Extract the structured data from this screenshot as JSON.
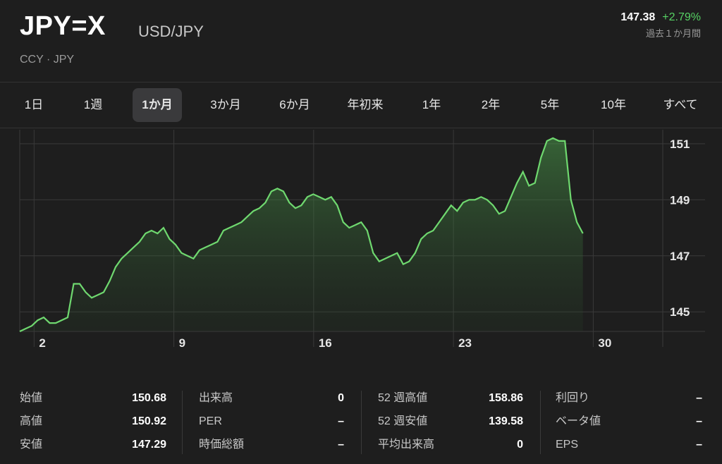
{
  "header": {
    "symbol": "JPY=X",
    "pair": "USD/JPY",
    "meta": "CCY · JPY",
    "price": "147.38",
    "change": "+2.79%",
    "period": "過去１か月間",
    "change_color": "#56d364"
  },
  "tabs": [
    {
      "label": "1日"
    },
    {
      "label": "1週"
    },
    {
      "label": "1か月",
      "active": true
    },
    {
      "label": "3か月"
    },
    {
      "label": "6か月"
    },
    {
      "label": "年初来"
    },
    {
      "label": "1年"
    },
    {
      "label": "2年"
    },
    {
      "label": "5年"
    },
    {
      "label": "10年"
    },
    {
      "label": "すべて"
    }
  ],
  "chart_data": {
    "type": "area",
    "x_ticks": [
      "2",
      "9",
      "16",
      "23",
      "30"
    ],
    "y_ticks": [
      "151",
      "149",
      "147",
      "145"
    ],
    "ylim": [
      144.3,
      151.5
    ],
    "xlim": [
      0,
      32.2
    ],
    "grid": true,
    "line_color": "#6fd86f",
    "x": [
      0,
      0.3,
      0.6,
      0.9,
      1.2,
      1.5,
      1.8,
      2.1,
      2.4,
      2.7,
      3.0,
      3.3,
      3.6,
      3.9,
      4.2,
      4.5,
      4.8,
      5.1,
      5.4,
      5.7,
      6.0,
      6.3,
      6.6,
      6.9,
      7.2,
      7.5,
      7.8,
      8.1,
      8.4,
      8.7,
      9.0,
      9.3,
      9.6,
      9.9,
      10.2,
      10.5,
      10.8,
      11.1,
      11.4,
      11.7,
      12.0,
      12.3,
      12.6,
      12.9,
      13.2,
      13.5,
      13.8,
      14.1,
      14.4,
      14.7,
      15.0,
      15.3,
      15.6,
      15.9,
      16.2,
      16.5,
      16.8,
      17.1,
      17.4,
      17.7,
      18.0,
      18.3,
      18.6,
      18.9,
      19.2,
      19.5,
      19.8,
      20.1,
      20.4,
      20.7,
      21.0,
      21.3,
      21.6,
      21.9,
      22.2,
      22.5,
      22.8,
      23.1,
      23.4,
      23.7,
      24.0,
      24.3,
      24.6,
      24.9,
      25.2,
      25.5,
      25.8,
      26.1,
      26.4,
      26.7,
      27.0,
      27.3,
      27.6,
      27.9,
      28.2,
      28.5,
      28.8,
      29.1,
      29.4,
      29.7,
      30.0,
      30.3,
      30.6,
      30.9,
      31.2,
      31.5,
      31.8,
      32.0
    ],
    "values": [
      144.3,
      144.4,
      144.5,
      144.7,
      144.8,
      144.6,
      144.6,
      144.7,
      144.8,
      146.0,
      146.0,
      145.7,
      145.5,
      145.6,
      145.7,
      146.1,
      146.6,
      146.9,
      147.1,
      147.3,
      147.5,
      147.8,
      147.9,
      147.8,
      148.0,
      147.6,
      147.4,
      147.1,
      147.0,
      146.9,
      147.2,
      147.3,
      147.4,
      147.5,
      147.9,
      148.0,
      148.1,
      148.2,
      148.4,
      148.6,
      148.7,
      148.9,
      149.3,
      149.4,
      149.3,
      148.9,
      148.7,
      148.8,
      149.1,
      149.2,
      149.1,
      149.0,
      149.1,
      148.8,
      148.2,
      148.0,
      148.1,
      148.2,
      147.9,
      147.1,
      146.8,
      146.9,
      147.0,
      147.1,
      146.7,
      146.8,
      147.1,
      147.6,
      147.8,
      147.9,
      148.2,
      148.5,
      148.8,
      148.6,
      148.9,
      149.0,
      149.0,
      149.1,
      149.0,
      148.8,
      148.5,
      148.6,
      149.1,
      149.6,
      150.0,
      149.5,
      149.6,
      150.5,
      151.1,
      151.2,
      151.1,
      151.1,
      149.0,
      148.2,
      147.8
    ]
  },
  "stats": [
    [
      {
        "label": "始値",
        "value": "150.68"
      },
      {
        "label": "高値",
        "value": "150.92"
      },
      {
        "label": "安値",
        "value": "147.29"
      }
    ],
    [
      {
        "label": "出来高",
        "value": "0"
      },
      {
        "label": "PER",
        "value": "–"
      },
      {
        "label": "時価総額",
        "value": "–"
      }
    ],
    [
      {
        "label": "52 週高値",
        "value": "158.86"
      },
      {
        "label": "52 週安値",
        "value": "139.58"
      },
      {
        "label": "平均出来高",
        "value": "0"
      }
    ],
    [
      {
        "label": "利回り",
        "value": "–"
      },
      {
        "label": "ベータ値",
        "value": "–"
      },
      {
        "label": "EPS",
        "value": "–"
      }
    ]
  ]
}
